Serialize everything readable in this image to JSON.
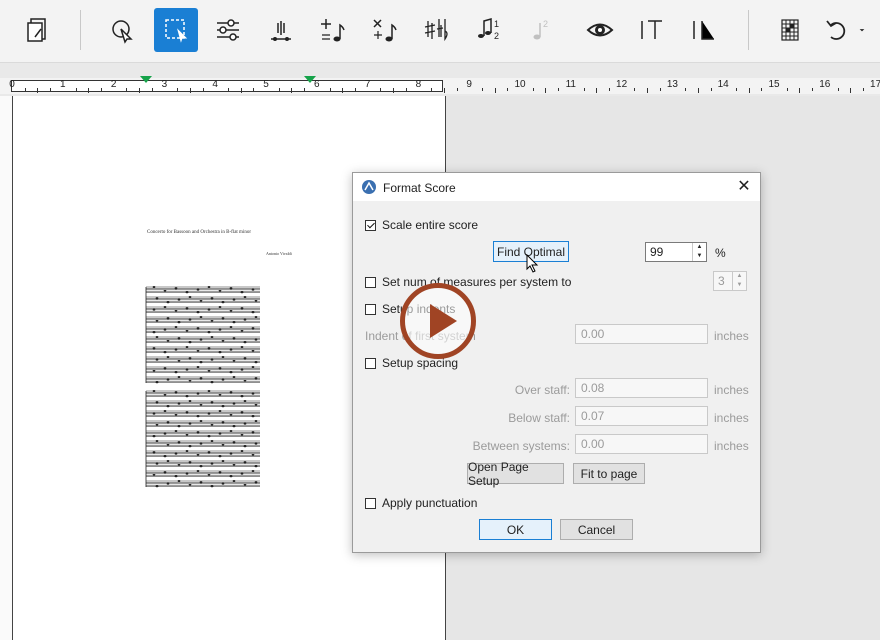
{
  "ruler": {
    "numbers": [
      "0",
      "1",
      "2",
      "3",
      "4",
      "5",
      "6",
      "7",
      "8",
      "9",
      "10",
      "11",
      "12",
      "13",
      "14",
      "15",
      "16",
      "17"
    ]
  },
  "toolbar": {
    "items": [
      {
        "icon": "document-icon"
      },
      {
        "icon": "pointer-icon"
      },
      {
        "icon": "selection-icon",
        "active": true
      },
      {
        "icon": "sliders-icon"
      },
      {
        "icon": "speaker-icon"
      },
      {
        "icon": "add-note-icon"
      },
      {
        "icon": "remove-note-icon"
      },
      {
        "icon": "accidentals-icon"
      },
      {
        "icon": "fingering-icon"
      },
      {
        "icon": "fingering-disabled-icon"
      },
      {
        "icon": "eye-icon"
      },
      {
        "icon": "text-icon"
      },
      {
        "icon": "lyrics-icon"
      },
      {
        "icon": "chord-grid-icon"
      },
      {
        "icon": "undo-icon"
      }
    ]
  },
  "score": {
    "title": "Concerto for Bassoon and Orchestra in B-flat minor",
    "composer": "Antonio Vivaldi"
  },
  "dialog": {
    "title": "Format Score",
    "scale_entire_score": {
      "label": "Scale entire score",
      "checked": true
    },
    "find_optimal": "Find Optimal",
    "scale_value": "99",
    "scale_unit": "%",
    "measures_per_system": {
      "label": "Set num of measures per system to",
      "checked": false,
      "value": "3"
    },
    "setup_indents": {
      "label": "Setup indents",
      "checked": false
    },
    "indent_first_system": {
      "label": "Indent of first system",
      "value": "0.00",
      "unit": "inches"
    },
    "setup_spacing": {
      "label": "Setup spacing",
      "checked": false
    },
    "over_staff": {
      "label": "Over staff:",
      "value": "0.08",
      "unit": "inches"
    },
    "below_staff": {
      "label": "Below staff:",
      "value": "0.07",
      "unit": "inches"
    },
    "between_systems": {
      "label": "Between systems:",
      "value": "0.00",
      "unit": "inches"
    },
    "open_page_setup": "Open Page Setup",
    "fit_to_page": "Fit to page",
    "apply_punctuation": {
      "label": "Apply punctuation",
      "checked": false
    },
    "ok": "OK",
    "cancel": "Cancel"
  },
  "overlay": {
    "icon": "play-icon"
  },
  "colors": {
    "accent": "#1a7fd4",
    "play": "#a04424",
    "tab_marker": "#16a34a"
  }
}
